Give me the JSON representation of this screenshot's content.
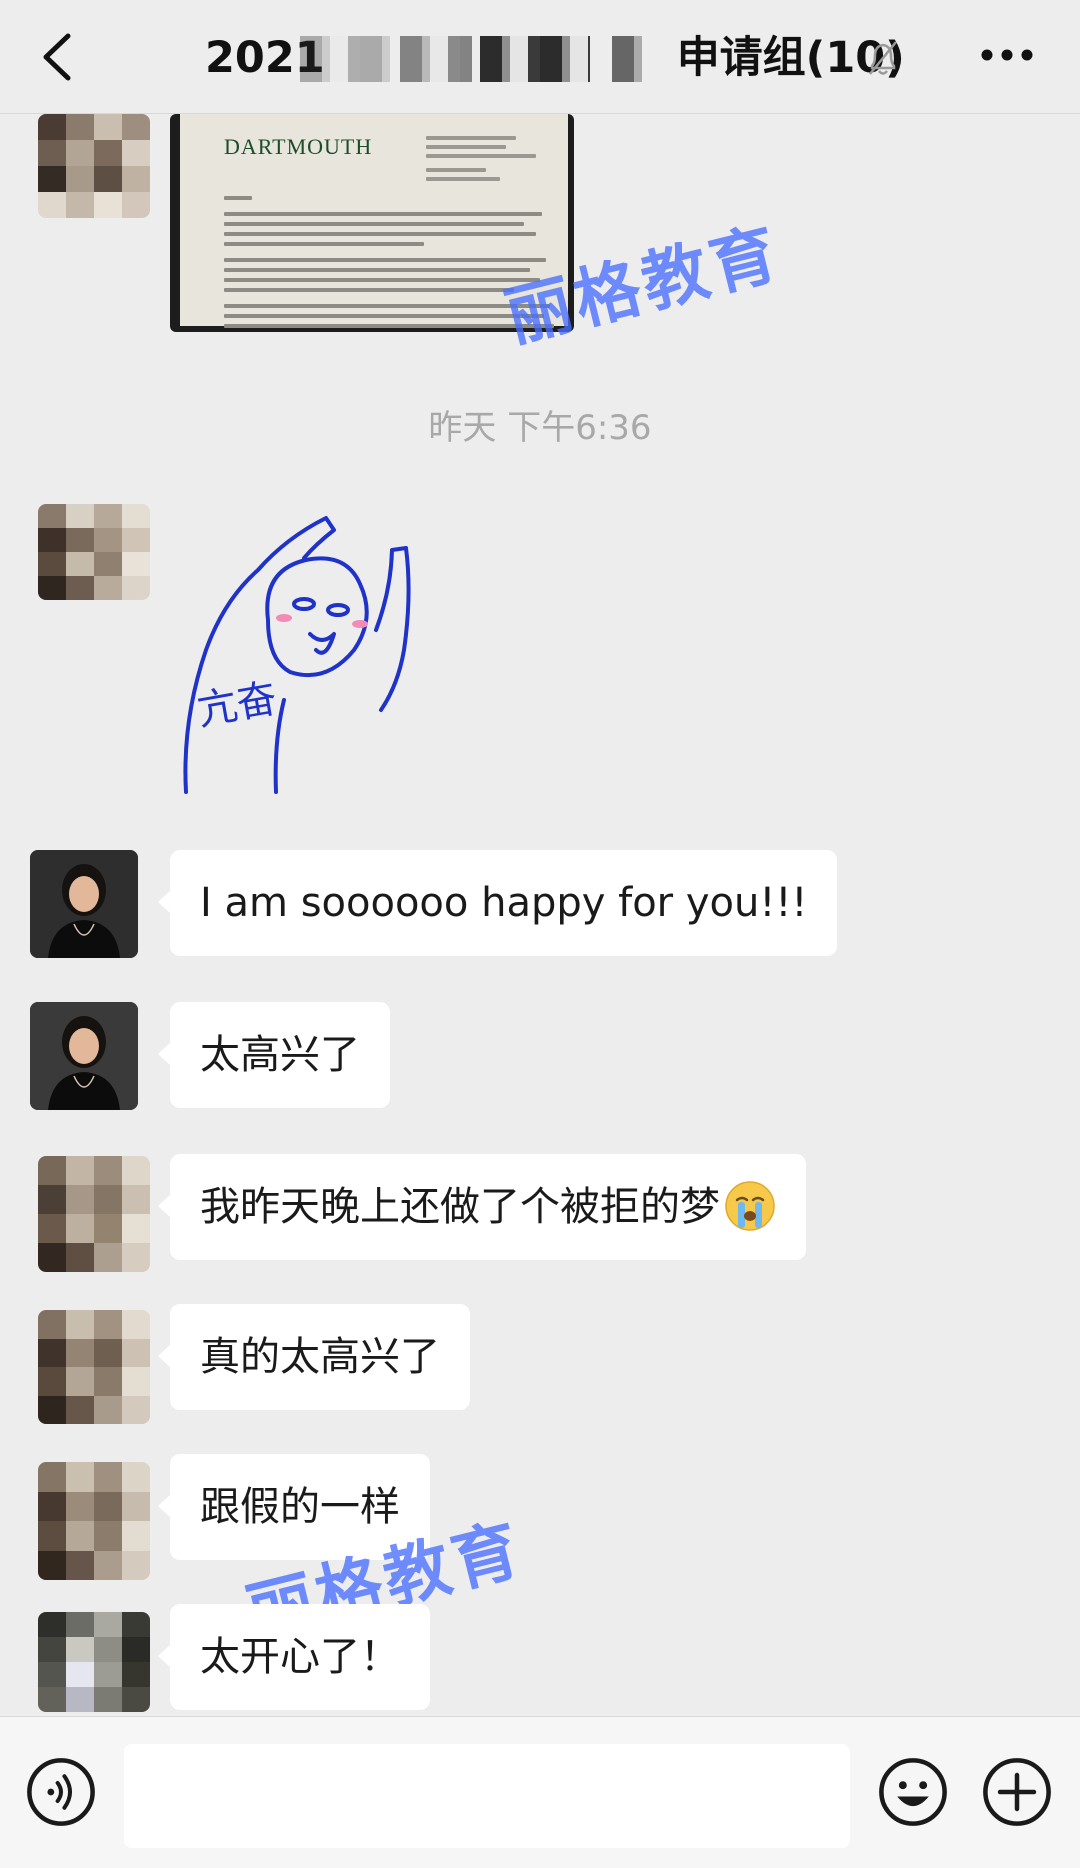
{
  "header": {
    "title_prefix": "2021",
    "title_suffix": "申请组(10)",
    "back_icon": "chevron-left-icon",
    "mute_icon": "bell-off-icon",
    "more_icon": "ellipsis-icon"
  },
  "messages": {
    "letter_image": {
      "brand": "DARTMOUTH"
    },
    "timestamp": "昨天 下午6:36",
    "sticker": {
      "text": "亢奋"
    },
    "texts": [
      "I am soooooo happy for you!!!",
      "太高兴了",
      "我昨天晚上还做了个被拒的梦",
      "真的太高兴了",
      "跟假的一样",
      "太开心了！"
    ],
    "emoji_icon": "crying-face-icon"
  },
  "watermark": {
    "text": "丽格教育"
  },
  "input_bar": {
    "voice_icon": "voice-icon",
    "emoji_icon": "smiley-icon",
    "plus_icon": "plus-icon",
    "value": ""
  },
  "colors": {
    "background": "#ededed",
    "bubble": "#ffffff",
    "watermark": "#486eff",
    "sticker_stroke": "#1f33c9",
    "timestamp": "#a8a8a8"
  }
}
